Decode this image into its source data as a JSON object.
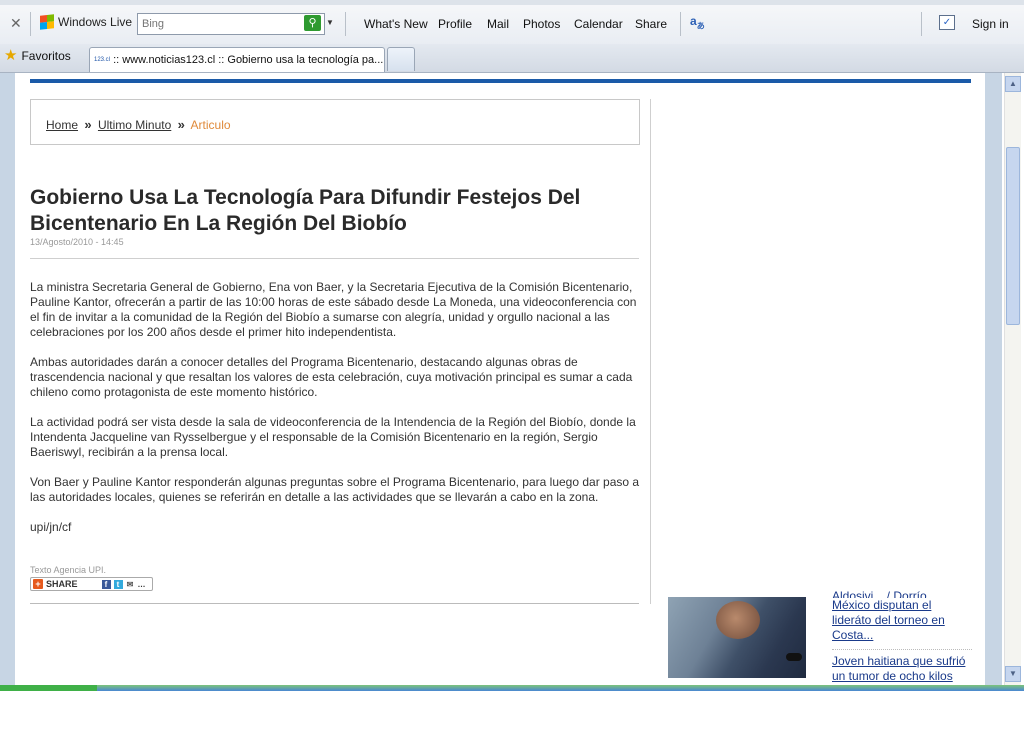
{
  "toolbar": {
    "close": "✕",
    "windows_live": "Windows Live",
    "search_placeholder": "Bing",
    "links": [
      "What's New",
      "Profile",
      "Mail",
      "Photos",
      "Calendar",
      "Share"
    ],
    "sign_in": "Sign in"
  },
  "tabs": {
    "favorites": "Favoritos",
    "active_tab": ":: www.noticias123.cl :: Gobierno usa la tecnología pa...",
    "favicon_text": "123.cl"
  },
  "breadcrumb": {
    "home": "Home",
    "sep": "»",
    "section": "Ultimo Minuto",
    "current": "Articulo"
  },
  "article": {
    "title": "Gobierno Usa La Tecnología Para Difundir Festejos Del Bicentenario En La Región Del Biobío",
    "date": "13/Agosto/2010 - 14:45",
    "paragraphs": [
      "La ministra Secretaria General de Gobierno, Ena von Baer, y la Secretaria Ejecutiva de la Comisión Bicentenario, Pauline Kantor, ofrecerán a partir de las 10:00 horas de este sábado desde La Moneda, una videoconferencia con el fin de invitar a la comunidad de la Región del Biobío a sumarse con alegría, unidad y orgullo nacional a las celebraciones por los 200 años desde el primer hito independentista.",
      "Ambas autoridades darán a conocer detalles del Programa Bicentenario, destacando algunas obras de trascendencia nacional y que resaltan los valores de esta celebración, cuya motivación principal es sumar a cada chileno como protagonista de este momento histórico.",
      "La actividad podrá ser vista desde la sala de videoconferencia de la Intendencia de la Región del Biobío, donde la Intendenta Jacqueline van Rysselbergue y el responsable de la Comisión Bicentenario en la región, Sergio Baeriswyl, recibirán a la prensa local.",
      "Von Baer y Pauline Kantor responderán algunas preguntas sobre el Programa Bicentenario, para luego dar paso a las autoridades locales, quienes se referirán en detalle a las actividades que se llevarán a cabo en la zona.",
      "upi/jn/cf"
    ],
    "source": "Texto Agencia UPI.",
    "share_label": "SHARE"
  },
  "sidebar": {
    "news": [
      "Aldosivi... / Dorrío",
      "México disputan el lideráto del torneo en Costa...",
      "Joven haitiana que sufrió un tumor de ocho kilos"
    ]
  },
  "colors": {
    "accent_blue": "#1a5aa8",
    "breadcrumb_current": "#e08a3a",
    "link": "#1a3a8a"
  },
  "icons": {
    "close": "close-icon",
    "search_go": "search-go-icon",
    "favorites": "star-icon",
    "translate": "translate-icon",
    "sign_in": "check-icon"
  }
}
